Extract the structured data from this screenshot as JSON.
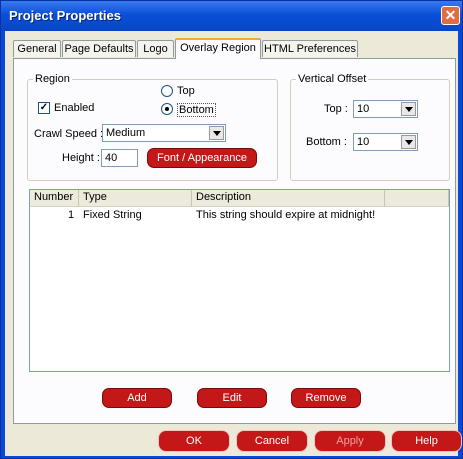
{
  "window": {
    "title": "Project Properties"
  },
  "tabs": [
    {
      "label": "General"
    },
    {
      "label": "Page Defaults"
    },
    {
      "label": "Logo"
    },
    {
      "label": "Overlay Region",
      "active": true
    },
    {
      "label": "HTML Preferences"
    }
  ],
  "region": {
    "legend": "Region",
    "enabled_label": "Enabled",
    "enabled_checked": true,
    "radio_top_label": "Top",
    "radio_bottom_label": "Bottom",
    "selected_position": "Bottom",
    "crawl_speed_label": "Crawl Speed :",
    "crawl_speed_value": "Medium",
    "height_label": "Height :",
    "height_value": "40",
    "font_button_label": "Font / Appearance"
  },
  "vertical_offset": {
    "legend": "Vertical Offset",
    "top_label": "Top :",
    "top_value": "10",
    "bottom_label": "Bottom :",
    "bottom_value": "10"
  },
  "list": {
    "columns": [
      "Number",
      "Type",
      "Description"
    ],
    "rows": [
      {
        "number": "1",
        "type": "Fixed String",
        "description": "This string should expire at midnight!"
      }
    ]
  },
  "actions": {
    "add": "Add",
    "edit": "Edit",
    "remove": "Remove"
  },
  "footer": {
    "ok": "OK",
    "cancel": "Cancel",
    "apply": "Apply",
    "help": "Help"
  },
  "colors": {
    "title_bar": "#0a4fd8",
    "button_red": "#c41818",
    "dialog_bg": "#ece9d8"
  }
}
